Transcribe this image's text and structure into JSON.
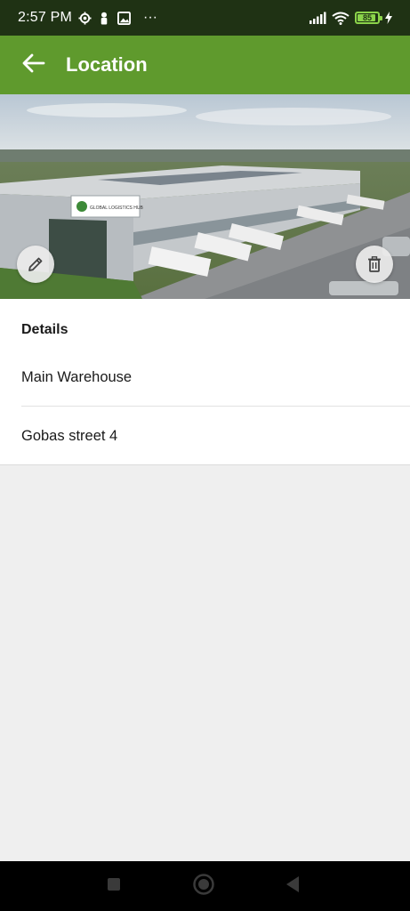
{
  "status_bar": {
    "time": "2:57 PM",
    "more": "···",
    "battery_percent": "85",
    "battery_level": 0.85
  },
  "app_bar": {
    "title": "Location"
  },
  "hero": {
    "sign_text": "GLOBAL LOGISTICS HUB"
  },
  "details": {
    "heading": "Details",
    "name": "Main Warehouse",
    "address": "Gobas street 4"
  },
  "colors": {
    "status_bar": "#1f3214",
    "app_bar": "#5f9a2d",
    "background": "#efefef",
    "battery": "#8bd34a"
  },
  "icons": {
    "back": "arrow-left-icon",
    "edit": "pencil-icon",
    "delete": "trash-icon"
  }
}
